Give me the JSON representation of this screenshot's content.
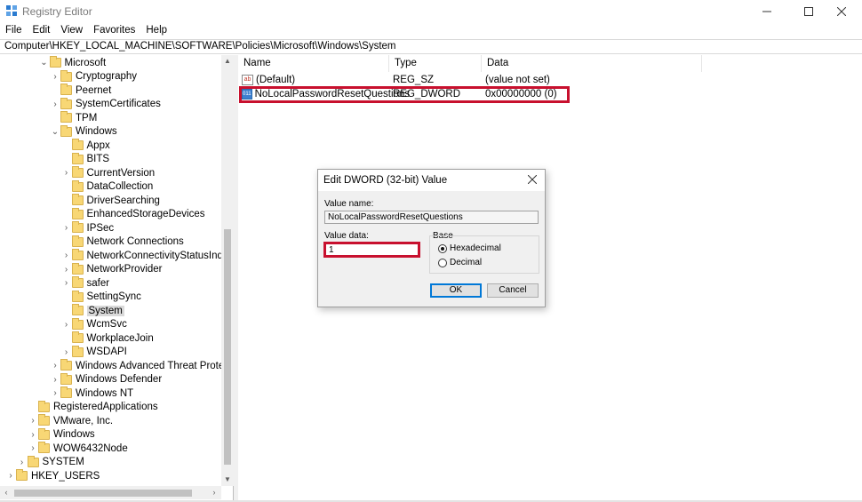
{
  "window": {
    "title": "Registry Editor"
  },
  "menu": [
    "File",
    "Edit",
    "View",
    "Favorites",
    "Help"
  ],
  "address": "Computer\\HKEY_LOCAL_MACHINE\\SOFTWARE\\Policies\\Microsoft\\Windows\\System",
  "tree": [
    {
      "label": "Microsoft",
      "indent": 3,
      "chevron": "v"
    },
    {
      "label": "Cryptography",
      "indent": 4,
      "chevron": ">"
    },
    {
      "label": "Peernet",
      "indent": 4,
      "chevron": ""
    },
    {
      "label": "SystemCertificates",
      "indent": 4,
      "chevron": ">"
    },
    {
      "label": "TPM",
      "indent": 4,
      "chevron": ""
    },
    {
      "label": "Windows",
      "indent": 4,
      "chevron": "v"
    },
    {
      "label": "Appx",
      "indent": 5,
      "chevron": ""
    },
    {
      "label": "BITS",
      "indent": 5,
      "chevron": ""
    },
    {
      "label": "CurrentVersion",
      "indent": 5,
      "chevron": ">"
    },
    {
      "label": "DataCollection",
      "indent": 5,
      "chevron": ""
    },
    {
      "label": "DriverSearching",
      "indent": 5,
      "chevron": ""
    },
    {
      "label": "EnhancedStorageDevices",
      "indent": 5,
      "chevron": ""
    },
    {
      "label": "IPSec",
      "indent": 5,
      "chevron": ">"
    },
    {
      "label": "Network Connections",
      "indent": 5,
      "chevron": ""
    },
    {
      "label": "NetworkConnectivityStatusIndic",
      "indent": 5,
      "chevron": ">"
    },
    {
      "label": "NetworkProvider",
      "indent": 5,
      "chevron": ">"
    },
    {
      "label": "safer",
      "indent": 5,
      "chevron": ">"
    },
    {
      "label": "SettingSync",
      "indent": 5,
      "chevron": ""
    },
    {
      "label": "System",
      "indent": 5,
      "chevron": "",
      "selected": true
    },
    {
      "label": "WcmSvc",
      "indent": 5,
      "chevron": ">"
    },
    {
      "label": "WorkplaceJoin",
      "indent": 5,
      "chevron": ""
    },
    {
      "label": "WSDAPI",
      "indent": 5,
      "chevron": ">"
    },
    {
      "label": "Windows Advanced Threat Protec",
      "indent": 4,
      "chevron": ">"
    },
    {
      "label": "Windows Defender",
      "indent": 4,
      "chevron": ">"
    },
    {
      "label": "Windows NT",
      "indent": 4,
      "chevron": ">"
    },
    {
      "label": "RegisteredApplications",
      "indent": 2,
      "chevron": ""
    },
    {
      "label": "VMware, Inc.",
      "indent": 2,
      "chevron": ">"
    },
    {
      "label": "Windows",
      "indent": 2,
      "chevron": ">"
    },
    {
      "label": "WOW6432Node",
      "indent": 2,
      "chevron": ">"
    },
    {
      "label": "SYSTEM",
      "indent": 1,
      "chevron": ">"
    },
    {
      "label": "HKEY_USERS",
      "indent": 0,
      "chevron": ">"
    }
  ],
  "list": {
    "columns": [
      "Name",
      "Type",
      "Data"
    ],
    "rows": [
      {
        "name": "(Default)",
        "type": "REG_SZ",
        "data": "(value not set)",
        "icon": "ab"
      },
      {
        "name": "NoLocalPasswordResetQuestions",
        "type": "REG_DWORD",
        "data": "0x00000000 (0)",
        "icon": "dword"
      }
    ]
  },
  "dialog": {
    "title": "Edit DWORD (32-bit) Value",
    "value_name_label": "Value name:",
    "value_name": "NoLocalPasswordResetQuestions",
    "value_data_label": "Value data:",
    "value_data": "1",
    "base_label": "Base",
    "hex_label": "Hexadecimal",
    "dec_label": "Decimal",
    "selected_base": "Hexadecimal",
    "ok_label": "OK",
    "cancel_label": "Cancel"
  },
  "colors": {
    "highlight": "#c8102e",
    "accent": "#0078d7",
    "folder": "#f8d775"
  }
}
